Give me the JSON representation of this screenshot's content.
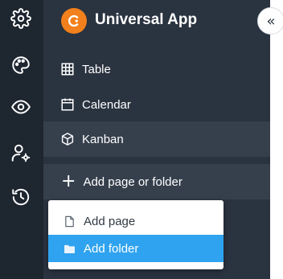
{
  "app": {
    "title": "Universal App",
    "brand_color": "#f2801c"
  },
  "rail": {
    "icons": [
      "gear-icon",
      "palette-icon",
      "eye-icon",
      "user-settings-icon",
      "history-icon"
    ]
  },
  "collapse": {
    "glyph": "«"
  },
  "sidebar": {
    "items": [
      {
        "label": "Table",
        "icon": "table-icon"
      },
      {
        "label": "Calendar",
        "icon": "calendar-icon"
      },
      {
        "label": "Kanban",
        "icon": "cube-icon",
        "active": true
      }
    ],
    "add": {
      "plus": "+",
      "label": "Add page or folder"
    }
  },
  "dropdown": {
    "items": [
      {
        "label": "Add page",
        "icon": "page-icon"
      },
      {
        "label": "Add folder",
        "icon": "folder-icon",
        "highlighted": true
      }
    ],
    "highlight_color": "#2fa3ef"
  }
}
